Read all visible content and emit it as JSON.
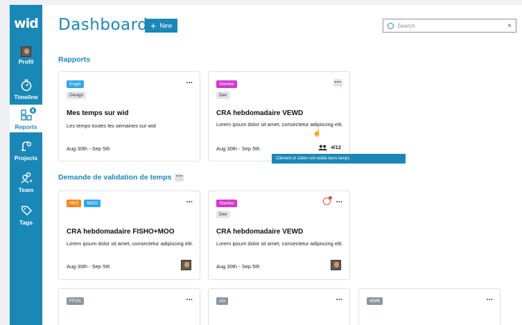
{
  "app": {
    "logo": "wid"
  },
  "sidebar": {
    "items": [
      {
        "label": "Profil",
        "icon": "avatar"
      },
      {
        "label": "Timeline",
        "icon": "stopwatch-icon"
      },
      {
        "label": "Reports",
        "icon": "reports-icon",
        "badge": "8",
        "active": true
      },
      {
        "label": "Projects",
        "icon": "projects-icon"
      },
      {
        "label": "Team",
        "icon": "team-icon"
      },
      {
        "label": "Tags",
        "icon": "tag-icon"
      }
    ]
  },
  "header": {
    "title": "Dashboard",
    "new_label": "New",
    "search_placeholder": "Search",
    "search_clear": "×"
  },
  "sections": {
    "rapports": "Rapports",
    "validation": "Demande de validation de temps",
    "validation_menu": "···"
  },
  "cards": {
    "c1": {
      "tags": [
        "Engie",
        "Design"
      ],
      "title": "Mes temps sur wid",
      "desc": "Les temps toutes les semaines sur wid",
      "date": "Aug 30th - Sep 5th",
      "menu": "···"
    },
    "c2": {
      "tags": [
        "Stantec",
        "Dev"
      ],
      "title": "CRA hebdomadaire VEWD",
      "desc": "Lorem ipsum dolor sit amet, consectetur adipiscing elit.",
      "date": "Aug 30th - Sep 5th",
      "count": "4/12",
      "menu": "···"
    },
    "c3": {
      "tags": [
        "HKS",
        "MOO"
      ],
      "title": "CRA hebdomadaire FISHO+MOO",
      "desc": "Lorem ipsum dolor sit amet, consectetur adipiscing elit.",
      "date": "Aug 30th - Sep 5th",
      "menu": "···"
    },
    "c4": {
      "tags": [
        "Stantec",
        "Dev"
      ],
      "title": "CRA hebdomadaire VEWD",
      "desc": "Lorem ipsum dolor sit amet, consectetur adipiscing elit.",
      "date": "Aug 30th - Sep 5th",
      "menu": "···"
    },
    "c5": {
      "tags": [
        "FFCK"
      ],
      "menu": "···"
    },
    "c6": {
      "tags": [
        "AG"
      ],
      "menu": "···"
    },
    "c7": {
      "tags": [
        "MMB"
      ],
      "menu": "···"
    }
  },
  "tooltip": "Clément et Julien ont validé leurs temps",
  "colors": {
    "brand": "#1a88b7",
    "stantec": "#d535cf",
    "engie": "#2fa6ea",
    "hks": "#f08a1c",
    "alert": "#e8473d"
  }
}
